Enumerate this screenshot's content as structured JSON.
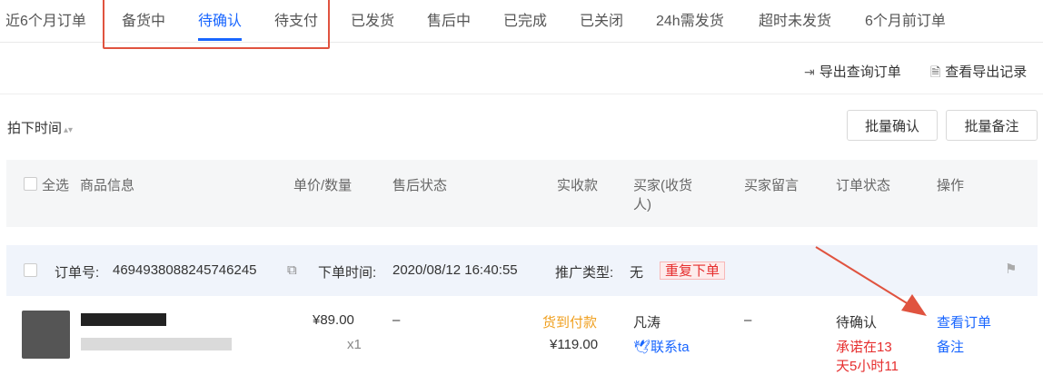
{
  "tabs": [
    {
      "label": "近6个月订单"
    },
    {
      "label": "备货中"
    },
    {
      "label": "待确认"
    },
    {
      "label": "待支付"
    },
    {
      "label": "已发货"
    },
    {
      "label": "售后中"
    },
    {
      "label": "已完成"
    },
    {
      "label": "已关闭"
    },
    {
      "label": "24h需发货"
    },
    {
      "label": "超时未发货"
    },
    {
      "label": "6个月前订单"
    }
  ],
  "toolbar": {
    "export_label": "导出查询订单",
    "view_export_label": "查看导出记录",
    "sort_label": "拍下时间",
    "batch_confirm": "批量确认",
    "batch_note": "批量备注"
  },
  "table": {
    "select_all": "全选",
    "headers": {
      "product": "商品信息",
      "price_qty": "单价/数量",
      "after_sale": "售后状态",
      "received": "实收款",
      "buyer_line1": "买家(收货",
      "buyer_line2": "人)",
      "message": "买家留言",
      "status": "订单状态",
      "action": "操作"
    }
  },
  "order": {
    "order_no_label": "订单号:",
    "order_no": "4694938088245746245",
    "time_label": "下单时间:",
    "time": "2020/08/12 16:40:55",
    "promo_label": "推广类型:",
    "promo": "无",
    "tag": "重复下单",
    "price": "¥89.00",
    "qty": "x1",
    "after_sale": "–",
    "payment_type": "货到付款",
    "total": "¥119.00",
    "buyer_name": "凡涛",
    "contact": "联系ta",
    "message": "–",
    "status": "待确认",
    "promise": "承诺在13",
    "promise_line2": "天5小时11",
    "view_order": "查看订单",
    "note": "备注"
  }
}
